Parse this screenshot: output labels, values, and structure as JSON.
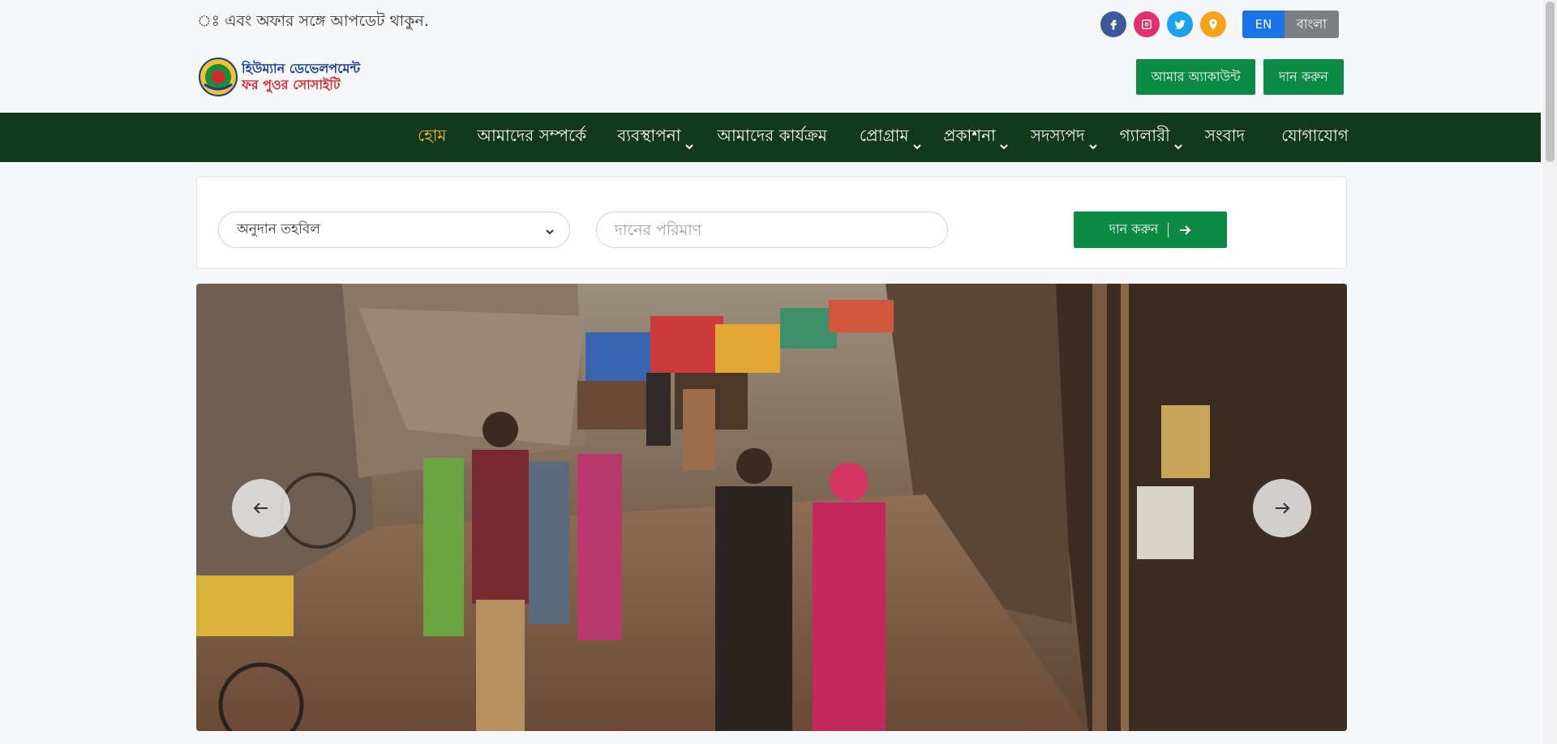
{
  "topbar": {
    "marquee": "ঃ এবং অফার সঙ্গে আপডেট থাকুন.",
    "languages": {
      "en": "EN",
      "bn": "বাংলা"
    }
  },
  "header": {
    "logo_line1": "হিউম্যান ডেভেলপমেন্ট",
    "logo_line2": "ফর পুওর সোসাইটি",
    "account_button": "আমার অ্যাকাউন্ট",
    "donate_button": "দান করুন"
  },
  "nav": {
    "items": [
      {
        "label": "হোম",
        "has_dropdown": false,
        "active": true
      },
      {
        "label": "আমাদের সম্পর্কে",
        "has_dropdown": false
      },
      {
        "label": "ব্যবস্থাপনা",
        "has_dropdown": true
      },
      {
        "label": "আমাদের কার্যক্রম",
        "has_dropdown": false
      },
      {
        "label": "প্রোগ্রাম",
        "has_dropdown": true
      },
      {
        "label": "প্রকাশনা",
        "has_dropdown": true
      },
      {
        "label": "সদস্যপদ",
        "has_dropdown": true
      },
      {
        "label": "গ্যালারী",
        "has_dropdown": true
      },
      {
        "label": "সংবাদ",
        "has_dropdown": false
      },
      {
        "label": "যোগাযোগ",
        "has_dropdown": false
      }
    ]
  },
  "donation": {
    "fund_select_value": "অনুদান তহবিল",
    "amount_placeholder": "দানের পরিমাণ",
    "submit_label": "দান করুন"
  },
  "icons": {
    "social": [
      "facebook-icon",
      "instagram-icon",
      "twitter-icon",
      "location-icon"
    ],
    "slider": [
      "arrow-left-icon",
      "arrow-right-icon"
    ]
  },
  "colors": {
    "nav_bg": "#12391c",
    "accent_green": "#0d8a46",
    "active_nav": "#f7b731",
    "lang_active": "#1a73e8"
  }
}
